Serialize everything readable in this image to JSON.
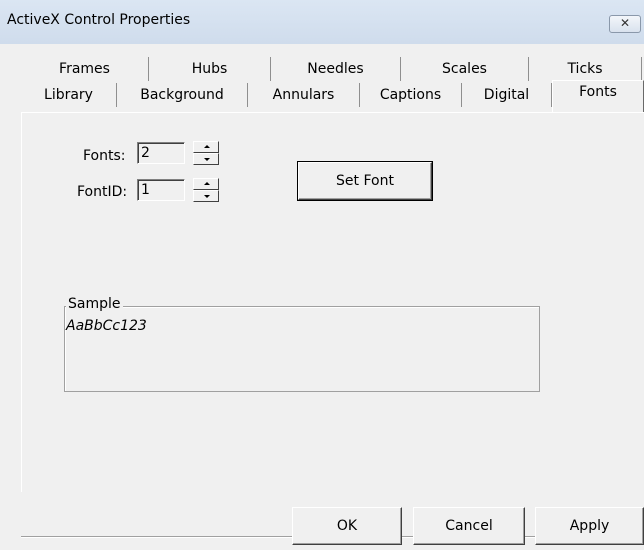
{
  "window": {
    "title": "ActiveX Control Properties",
    "close_glyph": "✕"
  },
  "tabs_row1": [
    "Frames",
    "Hubs",
    "Needles",
    "Scales",
    "Ticks"
  ],
  "tabs_row2": [
    "Library",
    "Background",
    "Annulars",
    "Captions",
    "Digital",
    "Fonts"
  ],
  "active_tab": "Fonts",
  "fonts_tab": {
    "fonts_label": "Fonts:",
    "fonts_value": "2",
    "fontid_label": "FontID:",
    "fontid_value": "1",
    "set_font_label": "Set Font",
    "sample_group_label": "Sample",
    "sample_text": "AaBbCc123"
  },
  "footer": {
    "ok_label": "OK",
    "cancel_label": "Cancel",
    "apply_label": "Apply"
  }
}
